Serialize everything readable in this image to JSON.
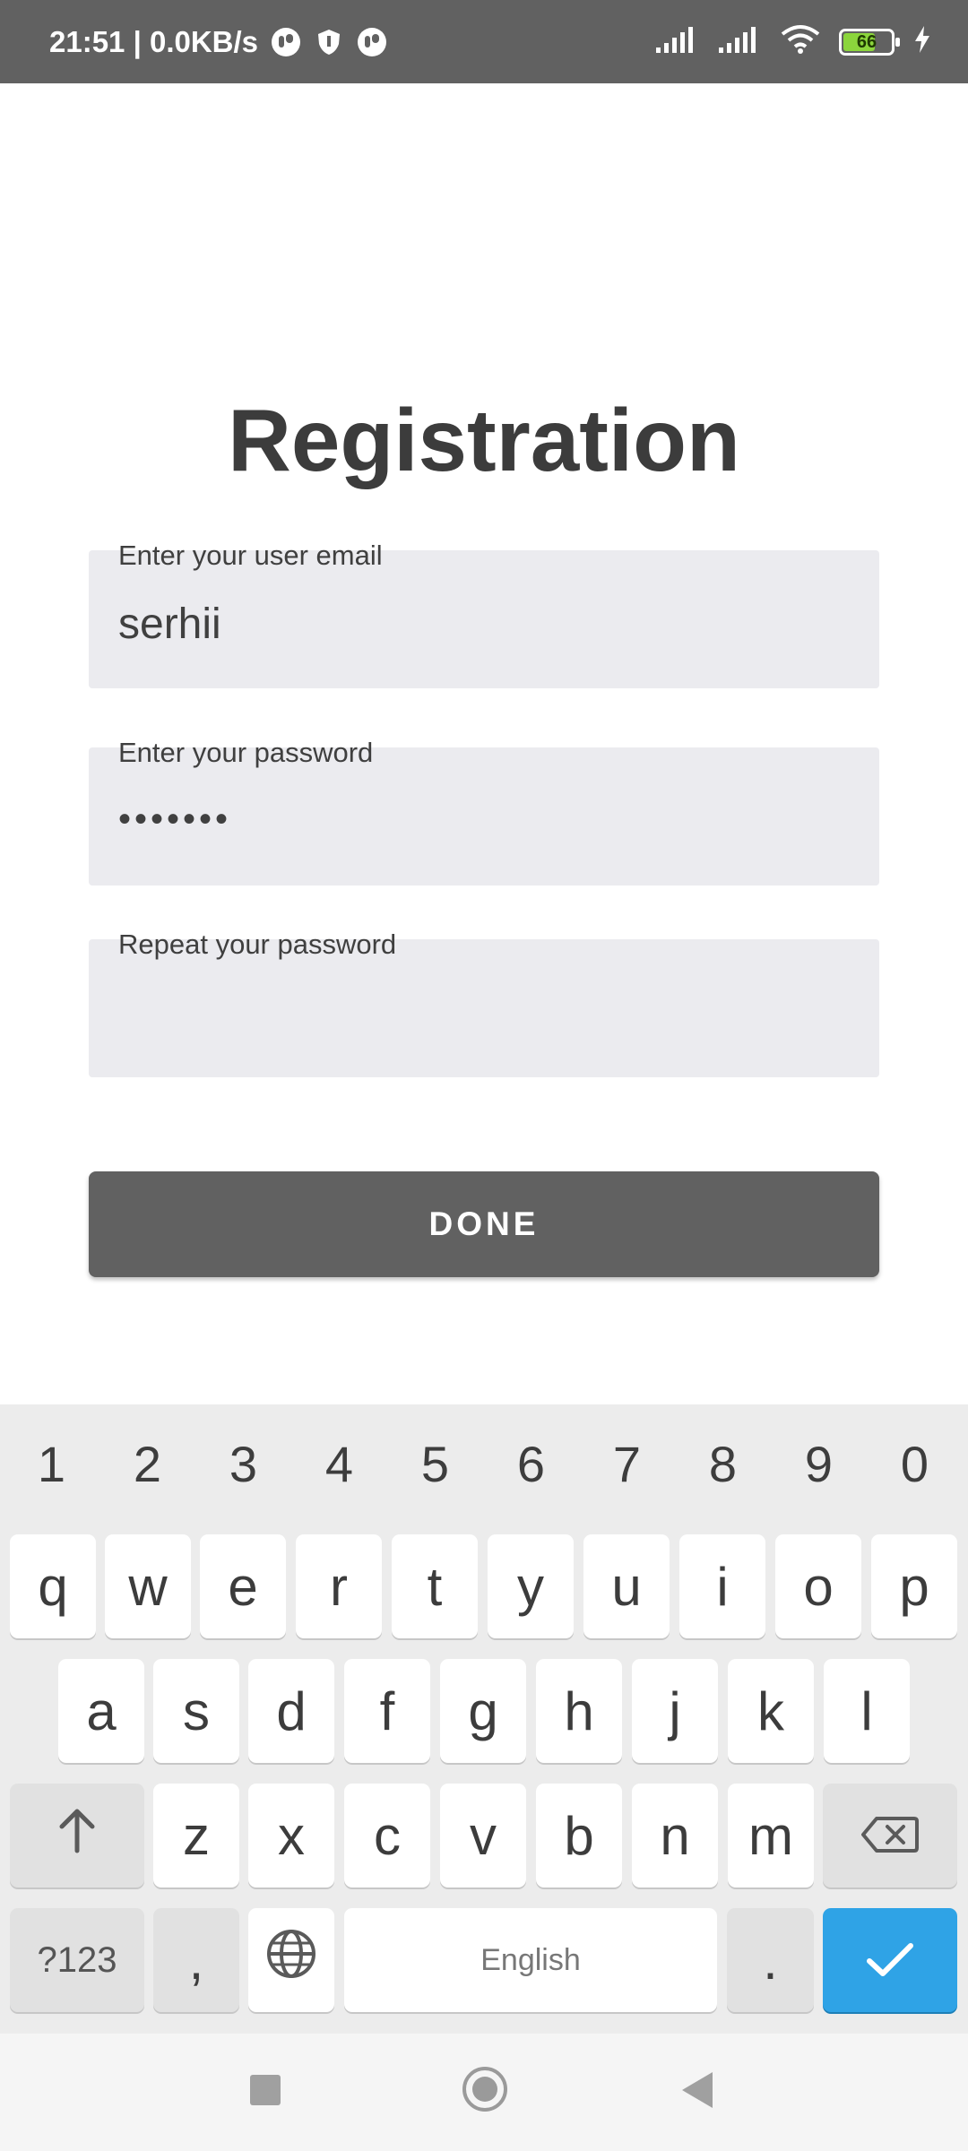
{
  "status_bar": {
    "time_speed": "21:51 | 0.0KB/s",
    "battery": "66",
    "icons": [
      "messenger-icon",
      "shield-icon",
      "messenger-icon",
      "signal-icon",
      "signal-icon",
      "wifi-icon",
      "battery-icon",
      "charging-icon"
    ]
  },
  "page": {
    "title": "Registration"
  },
  "form": {
    "email": {
      "label": "Enter your user email",
      "value": "serhii"
    },
    "password": {
      "label": "Enter your password",
      "value": "•••••••"
    },
    "repeat_password": {
      "label": "Repeat your password",
      "value": ""
    },
    "done_label": "DONE"
  },
  "keyboard": {
    "numbers": [
      "1",
      "2",
      "3",
      "4",
      "5",
      "6",
      "7",
      "8",
      "9",
      "0"
    ],
    "row1": [
      "q",
      "w",
      "e",
      "r",
      "t",
      "y",
      "u",
      "i",
      "o",
      "p"
    ],
    "row2": [
      "a",
      "s",
      "d",
      "f",
      "g",
      "h",
      "j",
      "k",
      "l"
    ],
    "row3": [
      "z",
      "x",
      "c",
      "v",
      "b",
      "n",
      "m"
    ],
    "symbols_label": "?123",
    "comma": ",",
    "space_label": "English",
    "period": ".",
    "icons": {
      "shift": "shift-icon",
      "backspace": "backspace-icon",
      "globe": "globe-icon",
      "enter": "checkmark-icon"
    },
    "enter_color": "#2fa3e6"
  },
  "nav_bar": {
    "icons": [
      "recents-icon",
      "home-icon",
      "back-icon"
    ]
  },
  "colors": {
    "status_bar_bg": "#616161",
    "button_bg": "#616161",
    "field_bg": "#ebebef",
    "battery_fill": "#8bd53c"
  }
}
